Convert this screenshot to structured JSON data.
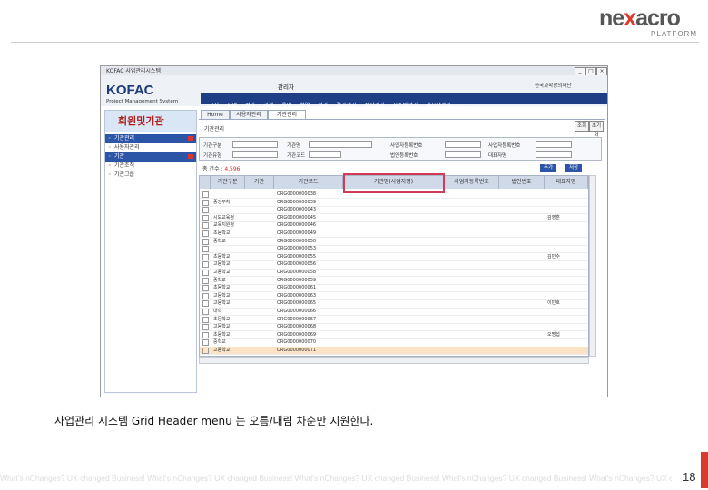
{
  "brand": {
    "logo_a": "ne",
    "logo_x": "x",
    "logo_b": "acro",
    "sub": "PLATFORM"
  },
  "caption": "사업관리 시스템 Grid Header menu 는 오름/내림 차순만 지원한다.",
  "footer_tagline": "What's nChanges? UX changed Business!  What's nChanges? UX changed Business!  What's nChanges? UX changed Business!  What's nChanges? UX changed Business!  What's nChanges? UX changed Business!",
  "page_number": "18",
  "app": {
    "window_title": "KOFAC 사업관리시스템",
    "window_buttons": [
      "_",
      "□",
      "×"
    ],
    "logo": "KOFAC",
    "logo_sub": "Project Management System",
    "user": "관리자",
    "dept": "한국과학창의재단",
    "main_nav": [
      "공지",
      "사업",
      "평가",
      "과제",
      "운영",
      "협약",
      "성과",
      "결과관리",
      "정산관리",
      "시스템관리",
      "게시판관리"
    ],
    "left_title": "회원및기관",
    "left_items": [
      {
        "label": "기관관리",
        "selected": true,
        "collapse": true
      },
      {
        "label": "사용자관리",
        "selected": false,
        "collapse": false
      },
      {
        "label": "기관",
        "selected": true,
        "collapse": true
      },
      {
        "label": "기관조직",
        "selected": false,
        "collapse": false
      },
      {
        "label": "기관그룹",
        "selected": false,
        "collapse": false
      }
    ],
    "sub_tabs": [
      "Home",
      "사용자관리",
      "기관관리"
    ],
    "breadcrumb": "기관관리",
    "search_buttons": [
      "조회",
      "초기화"
    ],
    "search_fields": [
      "기관구분",
      "기관명",
      "사업자등록번호",
      "사업자등록번호",
      "기관유형",
      "기관코드",
      "법인등록번호",
      "대표자명"
    ],
    "total_label": "총 건수 : ",
    "total_count": "4,596",
    "action_buttons": [
      "추가",
      "저장"
    ],
    "grid": {
      "headers": [
        "",
        "기관구분",
        "기관",
        "기관코드",
        "기관명(사업자명)",
        "사업자등록번호",
        "법인번호",
        "대표자명"
      ],
      "rows": [
        [
          "",
          "",
          "ORG0000000038",
          "",
          "",
          "",
          ""
        ],
        [
          "중앙부처",
          "",
          "ORG0000000039",
          "",
          "",
          "",
          ""
        ],
        [
          "",
          "",
          "ORG0000000043",
          "",
          "",
          "",
          ""
        ],
        [
          "시도교육청",
          "",
          "ORG0000000045",
          "",
          "",
          "",
          "김영훈"
        ],
        [
          "교육지원청",
          "",
          "ORG0000000046",
          "",
          "",
          "",
          ""
        ],
        [
          "초등학교",
          "",
          "ORG0000000049",
          "",
          "",
          "",
          ""
        ],
        [
          "중학교",
          "",
          "ORG0000000050",
          "",
          "",
          "",
          ""
        ],
        [
          "",
          "",
          "ORG0000000053",
          "",
          "",
          "",
          ""
        ],
        [
          "초등학교",
          "",
          "ORG0000000055",
          "",
          "",
          "",
          "김민수"
        ],
        [
          "고등학교",
          "",
          "ORG0000000056",
          "",
          "",
          "",
          ""
        ],
        [
          "고등학교",
          "",
          "ORG0000000058",
          "",
          "",
          "",
          ""
        ],
        [
          "중학교",
          "",
          "ORG0000000059",
          "",
          "",
          "",
          ""
        ],
        [
          "초등학교",
          "",
          "ORG0000000061",
          "",
          "",
          "",
          ""
        ],
        [
          "고등학교",
          "",
          "ORG0000000063",
          "",
          "",
          "",
          ""
        ],
        [
          "고등학교",
          "",
          "ORG0000000065",
          "",
          "",
          "",
          "이민호"
        ],
        [
          "대학",
          "",
          "ORG0000000066",
          "",
          "",
          "",
          ""
        ],
        [
          "초등학교",
          "",
          "ORG0000000067",
          "",
          "",
          "",
          ""
        ],
        [
          "고등학교",
          "",
          "ORG0000000068",
          "",
          "",
          "",
          ""
        ],
        [
          "초등학교",
          "",
          "ORG0000000069",
          "",
          "",
          "",
          "오명섭"
        ],
        [
          "중학교",
          "",
          "ORG0000000070",
          "",
          "",
          "",
          ""
        ],
        [
          "고등학교",
          "",
          "ORG0000000071",
          "",
          "",
          "",
          ""
        ]
      ],
      "selected_row": 20
    }
  }
}
